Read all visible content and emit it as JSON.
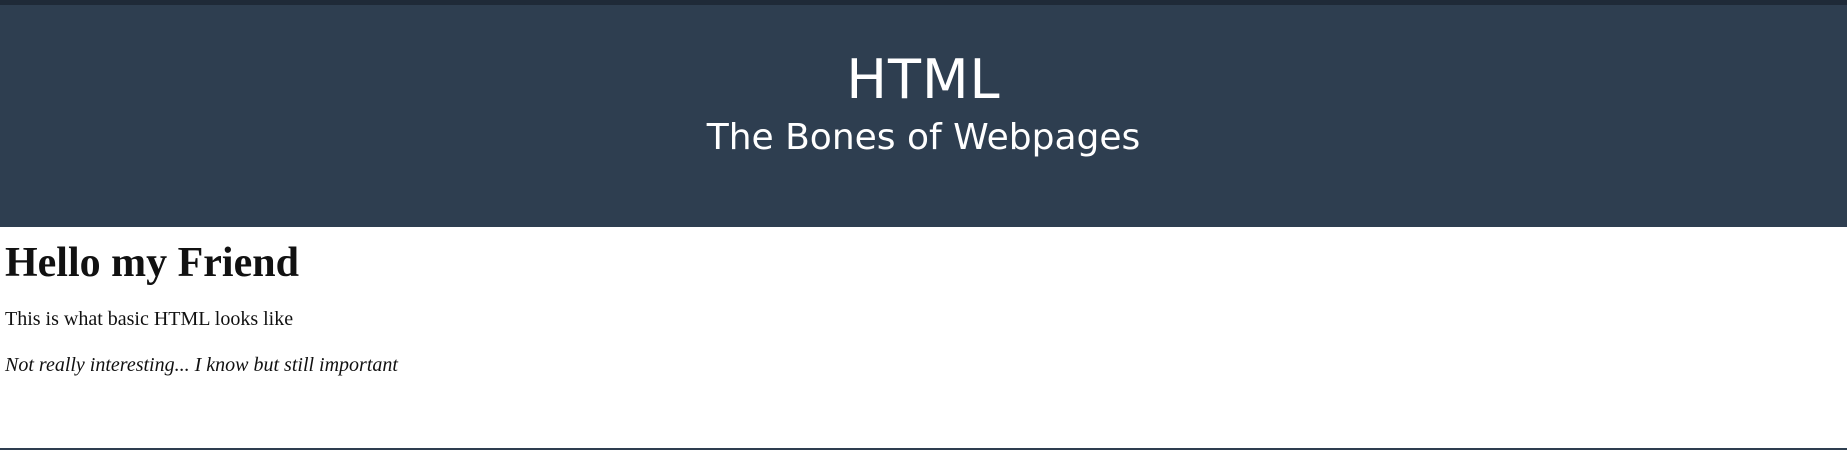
{
  "header": {
    "title": "HTML",
    "subtitle": "The Bones of Webpages"
  },
  "main": {
    "heading": "Hello my Friend",
    "paragraph": "This is what basic HTML looks like",
    "italic_note": "Not really interesting... I know but still important"
  },
  "colors": {
    "header_bg": "#2e3e50",
    "top_strip": "#1f2a38",
    "header_text": "#ffffff",
    "body_text": "#111111"
  }
}
